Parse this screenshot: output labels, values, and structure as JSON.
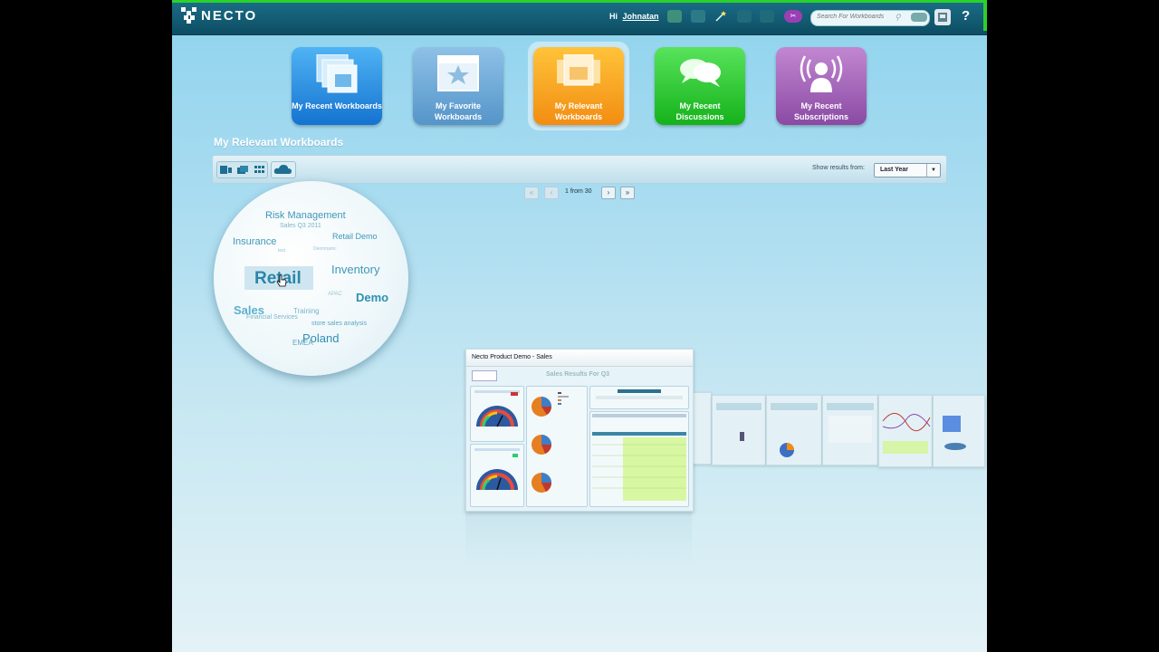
{
  "header": {
    "brand": "NECTO",
    "greeting_prefix": "Hi",
    "user": "Johnatan",
    "search_placeholder": "Search For Workboards",
    "help": "?"
  },
  "tiles": [
    {
      "label": "My Recent Workboards",
      "color": "#1f84dc"
    },
    {
      "label": "My Favorite Workboards",
      "color": "#6aa5d6"
    },
    {
      "label": "My Relevant Workboards",
      "color": "#f5a21e",
      "active": true
    },
    {
      "label": "My Recent Discussions",
      "color": "#22c227"
    },
    {
      "label": "My Recent Subscriptions",
      "color": "#a062b7"
    }
  ],
  "section_title": "My Relevant Workboards",
  "toolbar": {
    "show_results_label": "Show results from:",
    "period_value": "Last Year"
  },
  "pager": {
    "status": "1 from 30"
  },
  "tag_cloud": [
    {
      "text": "Risk Management",
      "size": 11
    },
    {
      "text": "Sales Q3 2011",
      "size": 7
    },
    {
      "text": "Insurance",
      "size": 11
    },
    {
      "text": "Retail Demo",
      "size": 9
    },
    {
      "text": "test",
      "size": 5
    },
    {
      "text": "Deomnamc",
      "size": 5
    },
    {
      "text": "Retail",
      "size": 19
    },
    {
      "text": "Inventory",
      "size": 13
    },
    {
      "text": "APAC",
      "size": 6
    },
    {
      "text": "Demo",
      "size": 13
    },
    {
      "text": "Sales",
      "size": 13
    },
    {
      "text": "Training",
      "size": 8
    },
    {
      "text": "Financial Services",
      "size": 7
    },
    {
      "text": "store sales analysis",
      "size": 7
    },
    {
      "text": "Poland",
      "size": 13
    },
    {
      "text": "EMEA",
      "size": 8
    }
  ],
  "featured_workboard": {
    "title": "Necto Product Demo - Sales",
    "subtitle": "Sales Results For Q3"
  }
}
